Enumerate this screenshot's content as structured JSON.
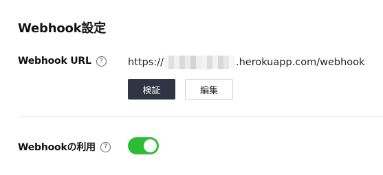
{
  "section": {
    "title": "Webhook設定"
  },
  "webhook_url": {
    "label": "Webhook URL",
    "url_prefix": "https://",
    "url_suffix": ".herokuapp.com/webhook",
    "verify_label": "検証",
    "edit_label": "編集"
  },
  "use_webhook": {
    "label": "Webhookの利用",
    "enabled": true
  },
  "colors": {
    "toggle_on": "#2bbd34",
    "primary_button": "#2f3542"
  },
  "icons": {
    "help": "question-circle-icon"
  }
}
